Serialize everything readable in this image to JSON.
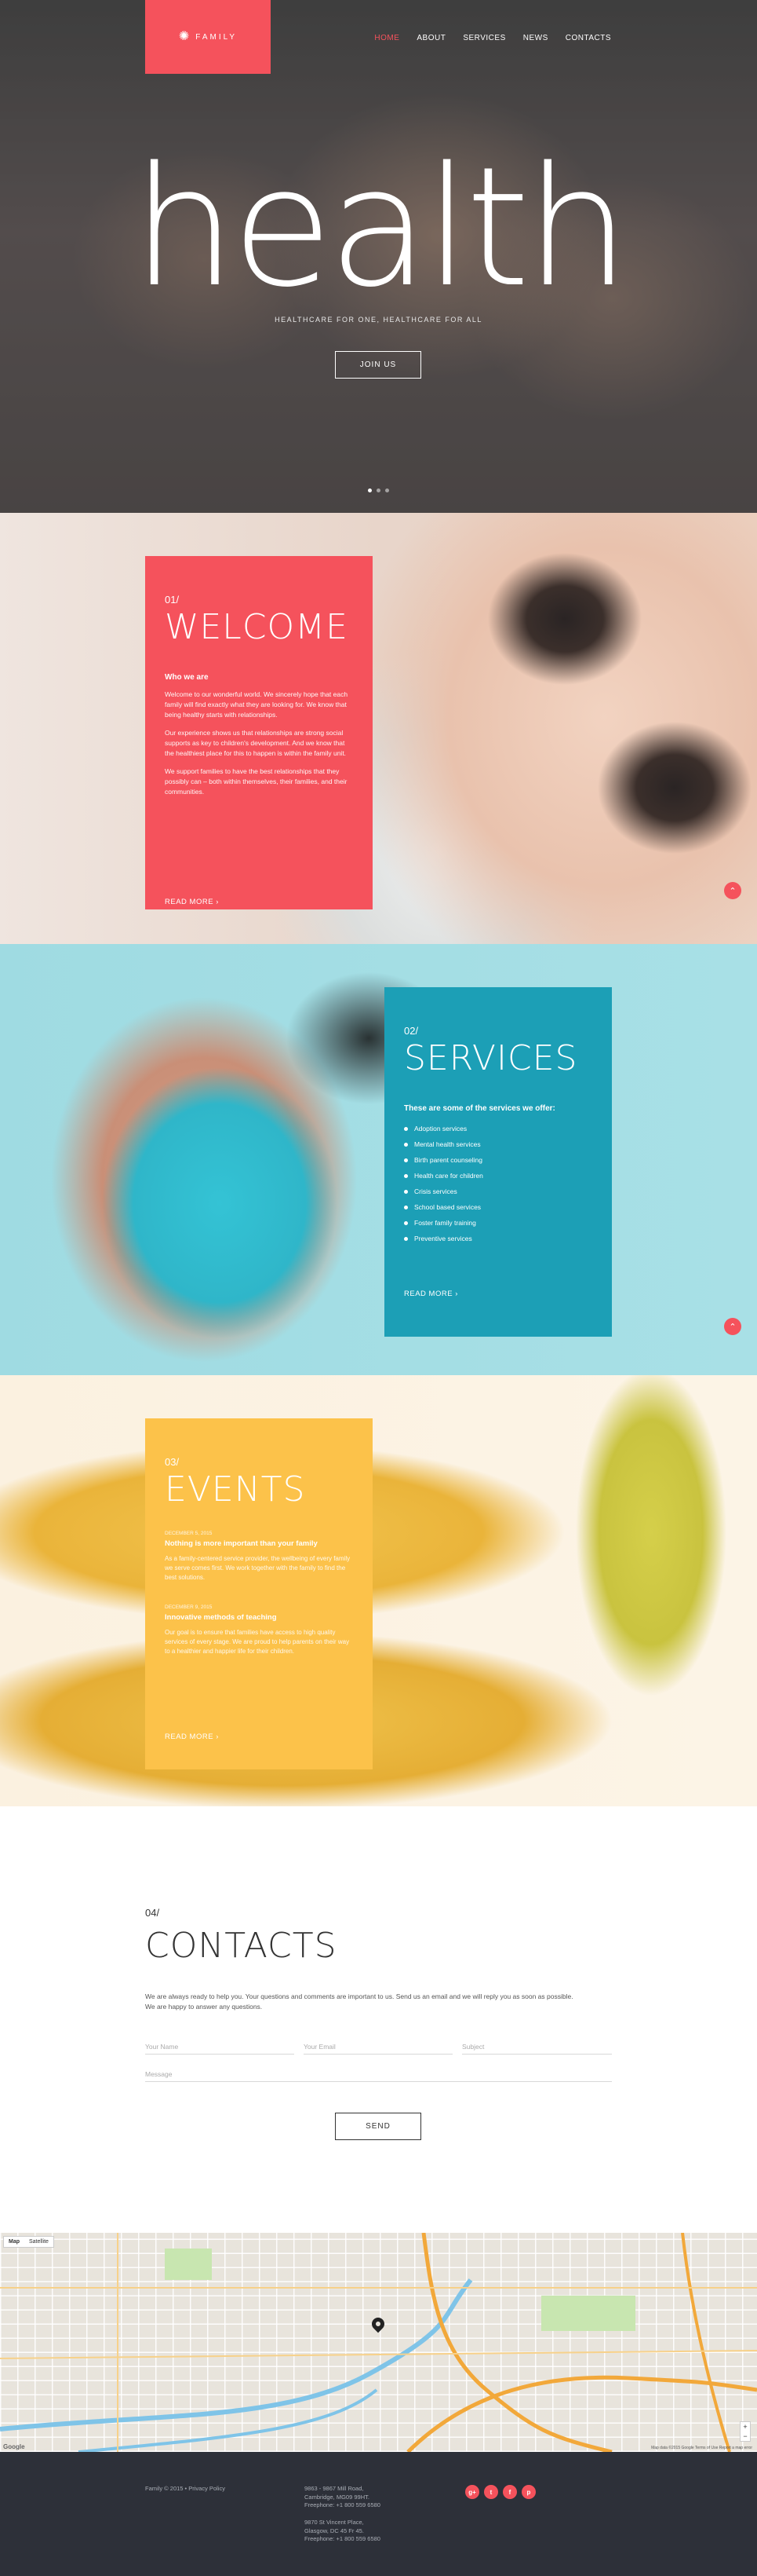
{
  "brand": {
    "logo_text": "FAMILY",
    "accent": "#f5525c"
  },
  "nav": {
    "items": [
      {
        "label": "HOME",
        "active": true
      },
      {
        "label": "ABOUT"
      },
      {
        "label": "SERVICES"
      },
      {
        "label": "NEWS"
      },
      {
        "label": "CONTACTS"
      }
    ]
  },
  "hero": {
    "title": "health",
    "subtitle": "HEALTHCARE FOR ONE, HEALTHCARE FOR ALL",
    "button": "JOIN US",
    "slides": 3,
    "active_slide": 1
  },
  "welcome": {
    "number": "01/",
    "title": "WELCOME",
    "subheading": "Who we are",
    "paragraphs": [
      "Welcome to our wonderful world. We sincerely hope that each family will find exactly what they are looking for. We know that being healthy starts with relationships.",
      "Our experience shows us that relationships are strong social supports as key to children's development. And we know that the healthiest place for this to happen is within the family unit.",
      "We support families to have the best relationships that they possibly can – both within themselves, their families, and their communities."
    ],
    "read_more": "READ MORE",
    "color": "#f5525c"
  },
  "services": {
    "number": "02/",
    "title": "SERVICES",
    "subheading": "These are some of the services we offer:",
    "items": [
      "Adoption services",
      "Mental health services",
      "Birth parent counseling",
      "Health care for children",
      "Crisis services",
      "School based services",
      "Foster family training",
      "Preventive services"
    ],
    "read_more": "READ MORE",
    "color": "#1c9fb6"
  },
  "events": {
    "number": "03/",
    "title": "EVENTS",
    "items": [
      {
        "date": "DECEMBER 5, 2015",
        "title": "Nothing is more important than your family",
        "desc": "As a family-centered service provider, the wellbeing of every family we serve comes first. We work together with the family to find the best solutions."
      },
      {
        "date": "DECEMBER 9, 2015",
        "title": "Innovative methods of teaching",
        "desc": "Our goal is to ensure that families have access to high quality services of every stage. We are proud to help parents on their way to a healthier and happier life for their children."
      }
    ],
    "read_more": "READ MORE",
    "color": "#fcc24a"
  },
  "contacts": {
    "number": "04/",
    "title": "CONTACTS",
    "text_line1": "We are always ready to help you. Your questions and comments are important to us. Send us an email and we will reply you as soon as possible.",
    "text_line2": "We are happy to answer any questions.",
    "name_placeholder": "Your Name",
    "email_placeholder": "Your Email",
    "subject_placeholder": "Subject",
    "message_placeholder": "Message",
    "send": "SEND"
  },
  "map": {
    "view_map": "Map",
    "view_satellite": "Satellite",
    "credit": "Map data ©2015 Google   Terms of Use   Report a map error",
    "google": "Google"
  },
  "footer": {
    "copyright": "Family © 2015 •",
    "privacy": "Privacy Policy",
    "address1": [
      "9863 - 9867 Mill Road,",
      "Cambridge, MG09 99HT.",
      "Freephone: +1 800 559 6580"
    ],
    "address2": [
      "9870 St Vincent Place,",
      "Glasgow, DC 45 Fr 45.",
      "Freephone: +1 800 559 6580"
    ],
    "social": [
      "g+",
      "t",
      "f",
      "p"
    ]
  }
}
